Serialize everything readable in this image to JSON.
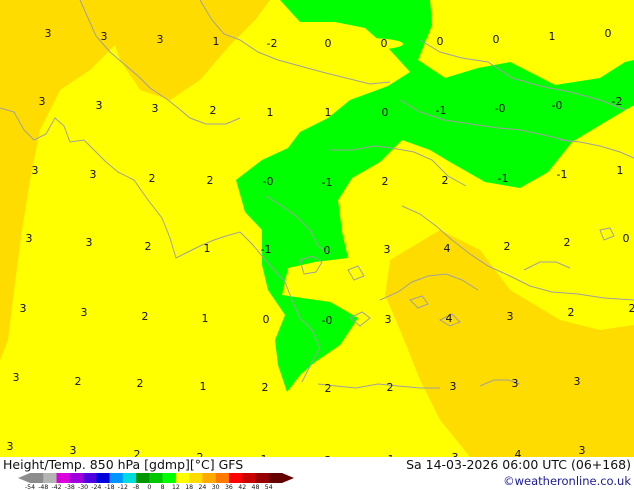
{
  "values": [
    {
      "text": "3"
    },
    {
      "text": "3"
    },
    {
      "text": "3"
    },
    {
      "text": "1"
    },
    {
      "text": "-2"
    },
    {
      "text": "0"
    },
    {
      "text": "0"
    },
    {
      "text": "0"
    },
    {
      "text": "0"
    },
    {
      "text": "1"
    },
    {
      "text": "0"
    },
    {
      "text": "3"
    },
    {
      "text": "3"
    },
    {
      "text": "3"
    },
    {
      "text": "2"
    },
    {
      "text": "1"
    },
    {
      "text": "1"
    },
    {
      "text": "0"
    },
    {
      "text": "-1"
    },
    {
      "text": "-0"
    },
    {
      "text": "-0"
    },
    {
      "text": "-2"
    },
    {
      "text": "3"
    },
    {
      "text": "3"
    },
    {
      "text": "2"
    },
    {
      "text": "2"
    },
    {
      "text": "-0"
    },
    {
      "text": "-1"
    },
    {
      "text": "2"
    },
    {
      "text": "2"
    },
    {
      "text": "-1"
    },
    {
      "text": "-1"
    },
    {
      "text": "1"
    },
    {
      "text": "3"
    },
    {
      "text": "3"
    },
    {
      "text": "2"
    },
    {
      "text": "1"
    },
    {
      "text": "-1"
    },
    {
      "text": "0"
    },
    {
      "text": "3"
    },
    {
      "text": "4"
    },
    {
      "text": "2"
    },
    {
      "text": "2"
    },
    {
      "text": "0"
    },
    {
      "text": "3"
    },
    {
      "text": "3"
    },
    {
      "text": "2"
    },
    {
      "text": "1"
    },
    {
      "text": "0"
    },
    {
      "text": "-0"
    },
    {
      "text": "3"
    },
    {
      "text": "4"
    },
    {
      "text": "3"
    },
    {
      "text": "2"
    },
    {
      "text": "2"
    },
    {
      "text": "3"
    },
    {
      "text": "2"
    },
    {
      "text": "2"
    },
    {
      "text": "1"
    },
    {
      "text": "2"
    },
    {
      "text": "2"
    },
    {
      "text": "2"
    },
    {
      "text": "3"
    },
    {
      "text": "3"
    },
    {
      "text": "3"
    },
    {
      "text": "3"
    },
    {
      "text": "3"
    },
    {
      "text": "2"
    },
    {
      "text": "2"
    },
    {
      "text": "1"
    },
    {
      "text": "2"
    },
    {
      "text": "1"
    },
    {
      "text": "3"
    },
    {
      "text": "4"
    },
    {
      "text": "3"
    }
  ],
  "footer": {
    "title": "Height/Temp. 850 hPa [gdmp][°C] GFS",
    "datetime": "Sa 14-03-2026 06:00 UTC (06+168)",
    "credit": "©weatheronline.co.uk"
  },
  "legend": {
    "ticks": [
      "-54",
      "-48",
      "-42",
      "-38",
      "-30",
      "-24",
      "-18",
      "-12",
      "-8",
      "0",
      "8",
      "12",
      "18",
      "24",
      "30",
      "36",
      "42",
      "48",
      "54"
    ],
    "colors": [
      "#8c8c8c",
      "#b4b4b4",
      "#dc00dc",
      "#a000dc",
      "#5000dc",
      "#0000dc",
      "#0096ff",
      "#00dcdc",
      "#009600",
      "#00c800",
      "#00ff00",
      "#ffff00",
      "#ffdc00",
      "#ffaa00",
      "#ff7800",
      "#ff0000",
      "#c80000",
      "#960000",
      "#640000"
    ]
  },
  "colors": {
    "warm": "#ffff00",
    "warmer": "#ffdc00",
    "cold": "#00ff00",
    "coast": "#a0a0a0"
  }
}
